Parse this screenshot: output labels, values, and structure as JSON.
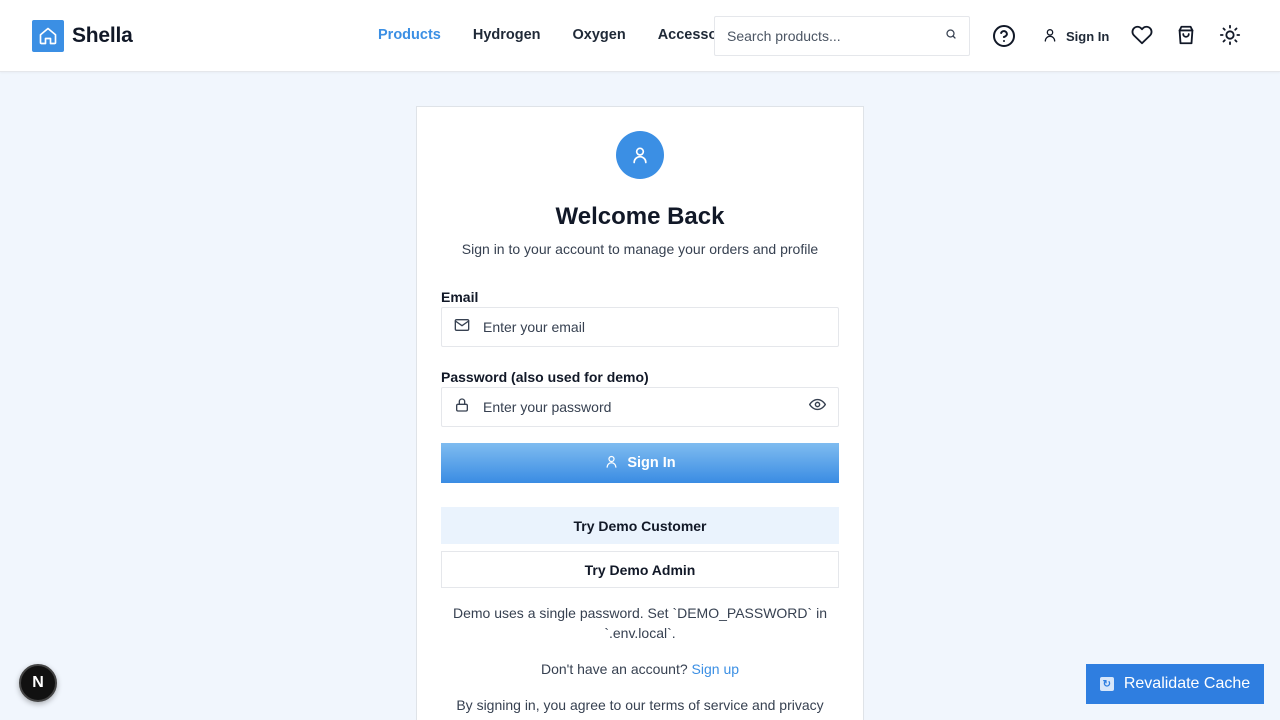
{
  "brand": {
    "name": "Shella"
  },
  "nav": {
    "items": [
      {
        "label": "Products",
        "active": true
      },
      {
        "label": "Hydrogen",
        "active": false
      },
      {
        "label": "Oxygen",
        "active": false
      },
      {
        "label": "Accessories",
        "active": false
      }
    ]
  },
  "search": {
    "placeholder": "Search products...",
    "value": ""
  },
  "header_actions": {
    "help_icon": "help-circle-icon",
    "signin_label": "Sign In",
    "wishlist_icon": "heart-icon",
    "cart_icon": "shopping-bag-icon",
    "theme_icon": "sun-icon"
  },
  "login": {
    "title": "Welcome Back",
    "subtitle": "Sign in to your account to manage your orders and profile",
    "email_label": "Email",
    "email_placeholder": "Enter your email",
    "password_label": "Password (also used for demo)",
    "password_placeholder": "Enter your password",
    "signin_button": "Sign In",
    "demo_customer_button": "Try Demo Customer",
    "demo_admin_button": "Try Demo Admin",
    "demo_note": "Demo uses a single password. Set `DEMO_PASSWORD` in `.env.local`.",
    "signup_prompt": "Don't have an account?",
    "signup_link": "Sign up",
    "terms_text": "By signing in, you agree to our terms of service and privacy"
  },
  "floating": {
    "next_badge": "N",
    "revalidate_label": "Revalidate Cache"
  },
  "colors": {
    "accent": "#3b8fe4",
    "page_bg": "#f1f6fd",
    "revalidate_bg": "#2f7ee0"
  }
}
